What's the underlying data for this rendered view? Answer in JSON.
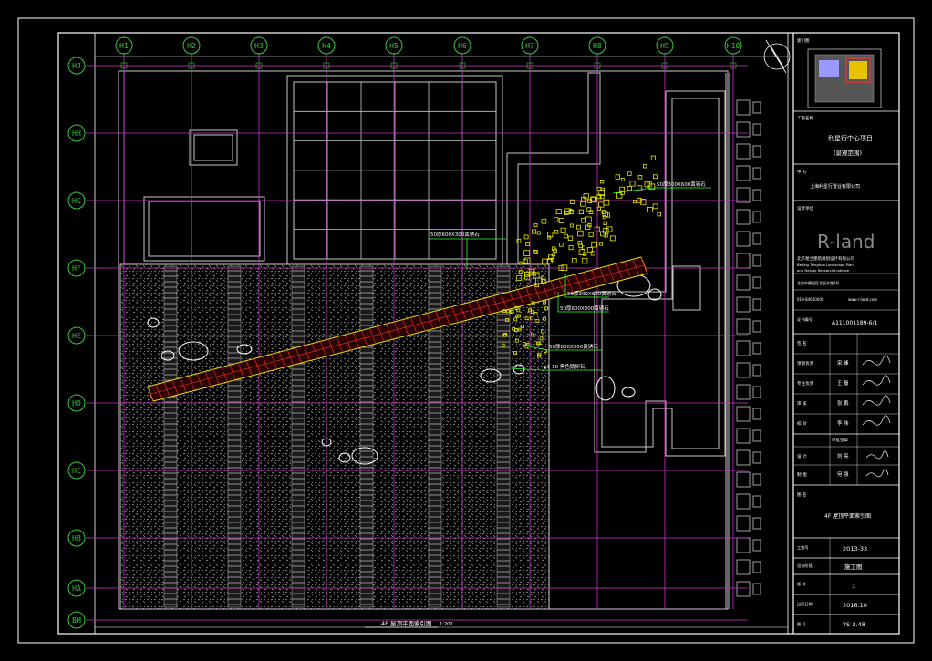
{
  "colors": {
    "background": "#000000",
    "frame": "#ffffff",
    "grid_line": "#cc33cc",
    "grid_bubble": "#33cc33",
    "outline": "#c8c8c8",
    "hatch": "#9a9a9a",
    "path_red": "#ff3030",
    "path_yellow": "#e6e600",
    "leader_green": "#33ff33",
    "logo_gray": "#8a8a8a"
  },
  "grid": {
    "columns": [
      "H1",
      "H2",
      "H3",
      "H4",
      "H5",
      "H6",
      "H7",
      "H8",
      "H9",
      "H10"
    ],
    "rows": [
      "HJ",
      "HH",
      "HG",
      "HF",
      "HE",
      "HD",
      "HC",
      "HB",
      "HA",
      "BM"
    ]
  },
  "annotations": [
    "50厚300X600黄锈石",
    "50厚600X300黄锈石",
    "50厚300X600黄锈石",
    "50厚600X300黄锈石",
    "50厚600X300黄锈石",
    "φ3-10 黑色鹅卵石"
  ],
  "plan_caption": {
    "title": "4F 屋顶平面索引图",
    "scale": "1:200"
  },
  "north_icon": "north-arrow-icon",
  "title_block": {
    "key_plan_label": "索引图",
    "project_label": "工程名称",
    "project_name": "利星行中心项目",
    "project_sub": "(景观范围)",
    "client_label": "甲 方",
    "client_name": "上海利星行置业有限公司",
    "designer_label": "设计单位",
    "logo": "R-land",
    "firm_line1": "北京易兰建筑规划设计有限公司",
    "firm_line2": "Beijing Tsinghua Landscape Plan",
    "firm_line3": "and Design Research Institute",
    "address": "北京市朝阳区北辰东路8号",
    "phone": "010-84600000",
    "email": "www.r-land.com",
    "cert_label": "证书编号",
    "cert_no": "A111001189-6/1",
    "sign_label": "签 名",
    "roles": [
      {
        "role": "项目负责",
        "name": "宋 峰"
      },
      {
        "role": "专业负责",
        "name": "王 磊"
      },
      {
        "role": "审 核",
        "name": "张 鹏"
      },
      {
        "role": "校 对",
        "name": "李 伟"
      }
    ],
    "review_label": "审批签章",
    "review_roles": [
      {
        "role": "设 计",
        "name": "刘 亮"
      },
      {
        "role": "制 图",
        "name": "何 强"
      }
    ],
    "title_label": "图 名",
    "drawing_title": "4F 屋顶平面索引图",
    "job_no_label": "工程号",
    "job_no": "2013-33",
    "phase_label": "设计阶段",
    "phase": "施工图",
    "version_label": "版 次",
    "version": "1",
    "date_label": "出图日期",
    "date": "2016.10",
    "sheet_label": "图 号",
    "sheet_no": "YS-2.48"
  }
}
